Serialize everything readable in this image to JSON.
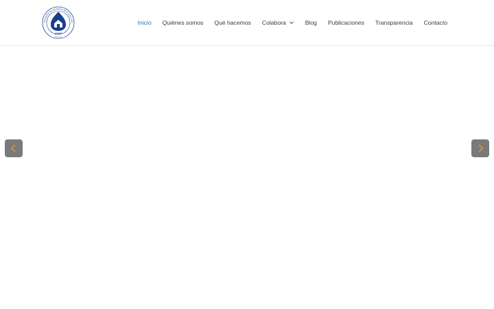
{
  "header": {
    "logo_text": "AVAF",
    "logo_ring_text": "Asociación de Voluntarios de Acción Formativa",
    "logo_sub": "Desde 1989"
  },
  "nav": {
    "items": [
      {
        "label": "Inicio",
        "active": true
      },
      {
        "label": "Quiénes somos"
      },
      {
        "label": "Qué hacemos"
      },
      {
        "label": "Colabora",
        "has_dropdown": true
      },
      {
        "label": "Blog"
      },
      {
        "label": "Publicaciones"
      },
      {
        "label": "Transparencia"
      },
      {
        "label": "Contacto"
      }
    ]
  },
  "slider": {
    "prev_icon": "chevron-left-icon",
    "next_icon": "chevron-right-icon"
  },
  "colors": {
    "accent": "#1e73be",
    "nav_text": "#3a3a3a",
    "arrow_bg": "#7a7a7a",
    "arrow_icon": "#e0a030",
    "logo_blue": "#1a3f8f"
  }
}
